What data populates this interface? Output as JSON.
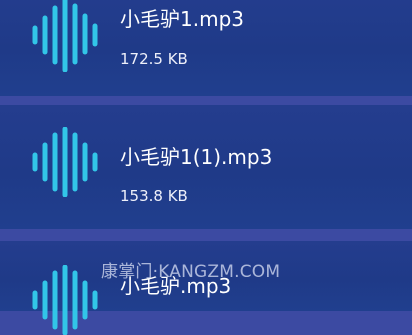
{
  "files": [
    {
      "name": "小毛驴1.mp3",
      "size": "172.5 KB",
      "icon": "audio-waveform-icon"
    },
    {
      "name": "小毛驴1(1).mp3",
      "size": "153.8 KB",
      "icon": "audio-waveform-icon"
    },
    {
      "name": "小毛驴.mp3",
      "icon": "audio-waveform-icon"
    }
  ],
  "watermark": "康掌门·KANGZM.COM",
  "colors": {
    "background": "#3c4aa2",
    "row": "#203c8c",
    "icon_accent": "#32c6e8",
    "text": "#ffffff"
  }
}
